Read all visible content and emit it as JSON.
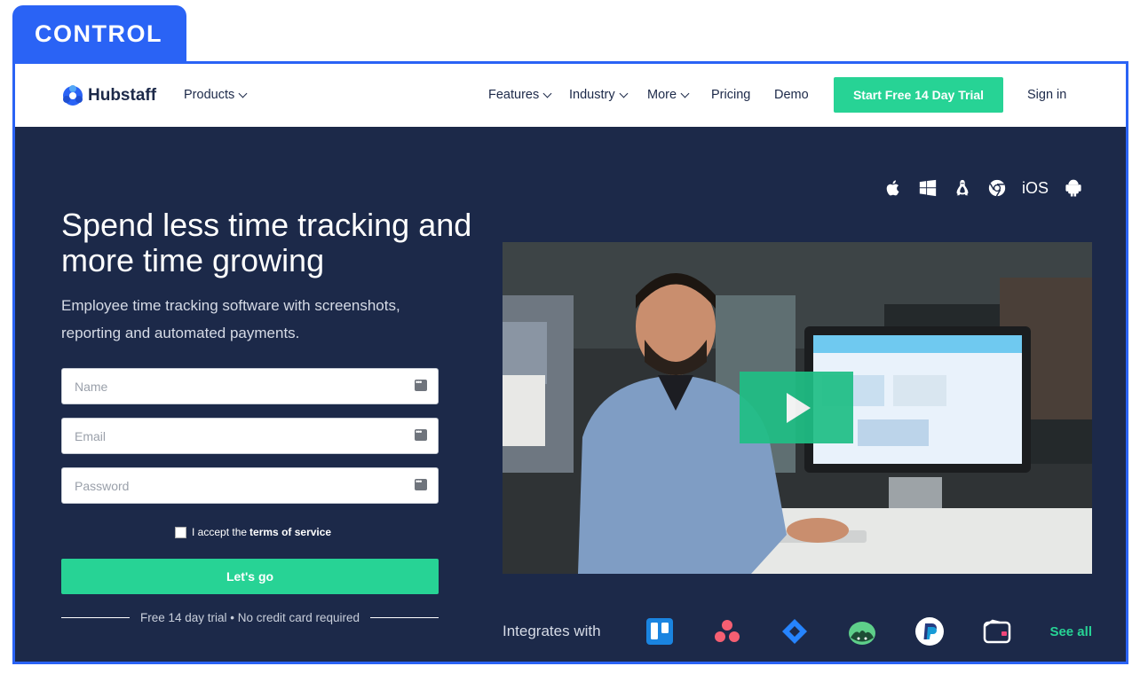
{
  "label": "CONTROL",
  "nav": {
    "brand": "Hubstaff",
    "products": "Products",
    "features": "Features",
    "industry": "Industry",
    "more": "More",
    "pricing": "Pricing",
    "demo": "Demo",
    "cta": "Start Free 14 Day Trial",
    "signin": "Sign in"
  },
  "hero": {
    "headline": "Spend less time tracking and more time growing",
    "subheadline": "Employee time tracking software with screenshots, reporting and automated payments."
  },
  "form": {
    "name_placeholder": "Name",
    "email_placeholder": "Email",
    "password_placeholder": "Password",
    "terms_prefix": "I accept the",
    "terms_link": "terms of service",
    "submit": "Let's go",
    "note": "Free 14 day trial • No credit card required"
  },
  "platforms": {
    "items": [
      "apple-icon",
      "windows-icon",
      "linux-icon",
      "chrome-icon",
      "ios-label",
      "android-icon"
    ],
    "ios_text": "iOS"
  },
  "integrations": {
    "label": "Integrates with",
    "logos": [
      "trello-icon",
      "asana-icon",
      "jira-icon",
      "basecamp-icon",
      "paypal-icon",
      "wallet-icon"
    ],
    "see_all": "See all"
  },
  "colors": {
    "accent": "#27d395",
    "hero_bg": "#1c2949",
    "frame": "#2a63f5"
  }
}
